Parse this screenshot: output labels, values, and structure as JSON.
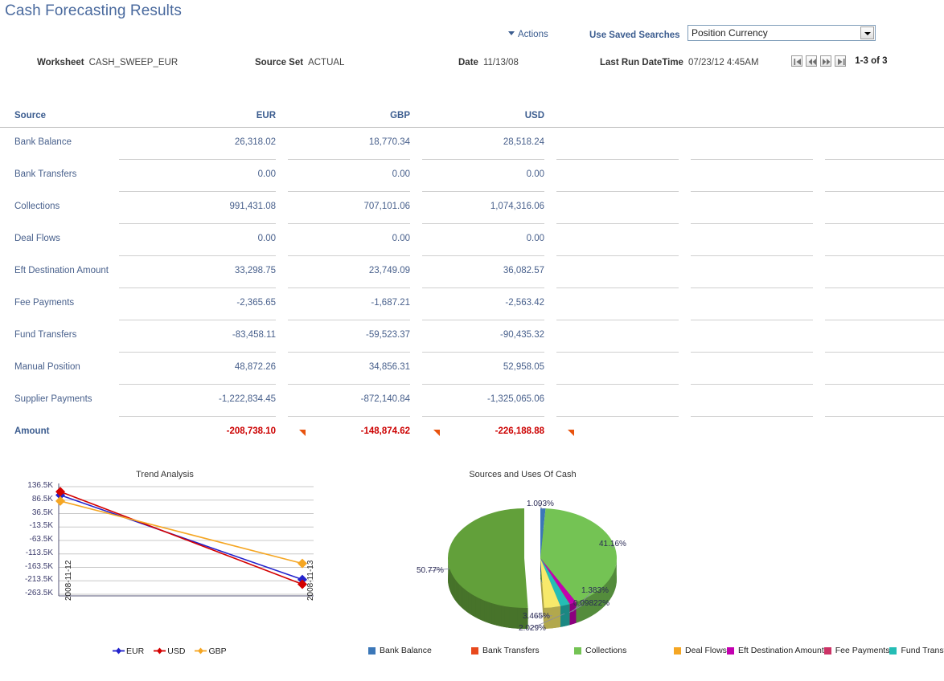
{
  "page_title": "Cash Forecasting Results",
  "toolbar": {
    "actions_label": "Actions",
    "saved_searches_label": "Use Saved Searches",
    "saved_search_value": "Position Currency"
  },
  "summary": {
    "worksheet_label": "Worksheet",
    "worksheet_value": "CASH_SWEEP_EUR",
    "source_set_label": "Source Set",
    "source_set_value": "ACTUAL",
    "date_label": "Date",
    "date_value": "11/13/08",
    "last_run_label": "Last Run DateTime",
    "last_run_value": "07/23/12  4:45AM"
  },
  "pager": {
    "count_text": "1-3 of 3",
    "first_label": "First",
    "previous_label": "Previous",
    "next_label": "Next",
    "last_label": "Last"
  },
  "grid": {
    "columns": [
      "Source",
      "EUR",
      "GBP",
      "USD",
      "",
      "",
      ""
    ],
    "rows": [
      {
        "source": "Bank Balance",
        "eur": "26,318.02",
        "gbp": "18,770.34",
        "usd": "28,518.24"
      },
      {
        "source": "Bank Transfers",
        "eur": "0.00",
        "gbp": "0.00",
        "usd": "0.00"
      },
      {
        "source": "Collections",
        "eur": "991,431.08",
        "gbp": "707,101.06",
        "usd": "1,074,316.06"
      },
      {
        "source": "Deal Flows",
        "eur": "0.00",
        "gbp": "0.00",
        "usd": "0.00"
      },
      {
        "source": "Eft Destination Amount",
        "eur": "33,298.75",
        "gbp": "23,749.09",
        "usd": "36,082.57"
      },
      {
        "source": "Fee Payments",
        "eur": "-2,365.65",
        "gbp": "-1,687.21",
        "usd": "-2,563.42"
      },
      {
        "source": "Fund Transfers",
        "eur": "-83,458.11",
        "gbp": "-59,523.37",
        "usd": "-90,435.32"
      },
      {
        "source": "Manual Position",
        "eur": "48,872.26",
        "gbp": "34,856.31",
        "usd": "52,958.05"
      },
      {
        "source": "Supplier Payments",
        "eur": "-1,222,834.45",
        "gbp": "-872,140.84",
        "usd": "-1,325,065.06"
      }
    ],
    "total_row": {
      "source": "Amount",
      "eur": "-208,738.10",
      "gbp": "-148,874.62",
      "usd": "-226,188.88"
    },
    "total_color": "#cc0000",
    "trend_arrow_color": "#e8530e"
  },
  "chart_data": [
    {
      "type": "line",
      "title": "Trend Analysis",
      "xlabel": "",
      "ylabel": "",
      "x": [
        "2008-11-12",
        "2008-11-13"
      ],
      "ylim": [
        -263500,
        136500
      ],
      "yticks": [
        "136.5K",
        "86.5K",
        "36.5K",
        "-13.5K",
        "-63.5K",
        "-113.5K",
        "-163.5K",
        "-213.5K",
        "-263.5K"
      ],
      "ytick_values": [
        136500,
        86500,
        36500,
        -13500,
        -63500,
        -113500,
        -163500,
        -213500,
        -263500
      ],
      "grid": true,
      "legend_position": "bottom",
      "series": [
        {
          "name": "EUR",
          "color": "#2222cc",
          "values": [
            105000,
            -208738.1
          ]
        },
        {
          "name": "USD",
          "color": "#d40000",
          "values": [
            118000,
            -226188.88
          ]
        },
        {
          "name": "GBP",
          "color": "#f5a623",
          "values": [
            83000,
            -148874.62
          ]
        }
      ]
    },
    {
      "type": "pie",
      "title": "Sources and Uses Of Cash",
      "legend_position": "bottom",
      "labels": [
        "Bank Balance",
        "Bank Transfers",
        "Collections",
        "Deal Flows",
        "Eft Destination Amount",
        "Fee Payments",
        "Fund Transfers",
        "Manual Position",
        "Supplier Payments"
      ],
      "colors": [
        "#3b77b8",
        "#e8491d",
        "#74c354",
        "#f5a623",
        "#c300b0",
        "#cc3366",
        "#25bdb5",
        "#f7e96b",
        "#62a03a"
      ],
      "visible_percent_labels": [
        "1.093%",
        "41.16%",
        "1.383%",
        "0.09822%",
        "3.465%",
        "2.029%",
        "50.77%"
      ],
      "slices": [
        {
          "label": "Bank Balance",
          "percent": 1.093,
          "display": "1.093%"
        },
        {
          "label": "Collections",
          "percent": 41.16,
          "display": "41.16%"
        },
        {
          "label": "Eft Destination Amount",
          "percent": 1.383,
          "display": "1.383%"
        },
        {
          "label": "Fee Payments",
          "percent": 0.09822,
          "display": "0.09822%"
        },
        {
          "label": "Fund Transfers",
          "percent": 2.029,
          "display": "2.029%"
        },
        {
          "label": "Manual Position",
          "percent": 3.465,
          "display": "3.465%"
        },
        {
          "label": "Supplier Payments",
          "percent": 50.77,
          "display": "50.77%"
        }
      ]
    }
  ]
}
